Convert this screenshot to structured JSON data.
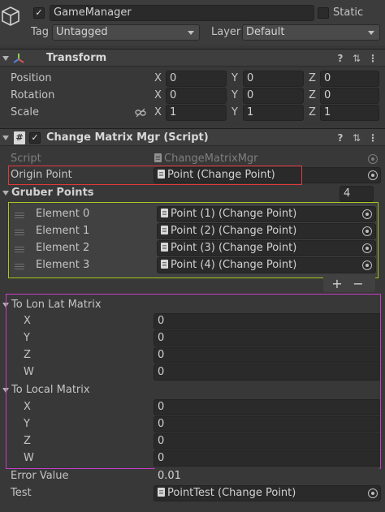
{
  "header": {
    "object_name": "GameManager",
    "static_label": "Static",
    "tag_label": "Tag",
    "tag_value": "Untagged",
    "layer_label": "Layer",
    "layer_value": "Default"
  },
  "transform": {
    "title": "Transform",
    "rows": [
      {
        "label": "Position",
        "x": "0",
        "y": "0",
        "z": "0"
      },
      {
        "label": "Rotation",
        "x": "0",
        "y": "0",
        "z": "0"
      },
      {
        "label": "Scale",
        "x": "1",
        "y": "1",
        "z": "1"
      }
    ],
    "axis_x": "X",
    "axis_y": "Y",
    "axis_z": "Z"
  },
  "script_component": {
    "title": "Change Matrix Mgr (Script)",
    "script_label": "Script",
    "script_value": "ChangeMatrixMgr",
    "origin_label": "Origin Point",
    "origin_value": "Point (Change Point)",
    "gruber_label": "Gruber Points",
    "gruber_count": "4",
    "elements": [
      {
        "label": "Element 0",
        "value": "Point (1) (Change Point)"
      },
      {
        "label": "Element 1",
        "value": "Point (2) (Change Point)"
      },
      {
        "label": "Element 2",
        "value": "Point (3) (Change Point)"
      },
      {
        "label": "Element 3",
        "value": "Point (4) (Change Point)"
      }
    ],
    "add_label": "+",
    "remove_label": "−",
    "lon_lat_label": "To Lon Lat Matrix",
    "lon_lat": [
      {
        "label": "X",
        "value": "0"
      },
      {
        "label": "Y",
        "value": "0"
      },
      {
        "label": "Z",
        "value": "0"
      },
      {
        "label": "W",
        "value": "0"
      }
    ],
    "local_label": "To Local Matrix",
    "local": [
      {
        "label": "X",
        "value": "0"
      },
      {
        "label": "Y",
        "value": "0"
      },
      {
        "label": "Z",
        "value": "0"
      },
      {
        "label": "W",
        "value": "0"
      }
    ],
    "error_label": "Error Value",
    "error_value": "0.01",
    "test_label": "Test",
    "test_value": "PointTest (Change Point)"
  },
  "colors": {
    "origin_highlight": "#e0393e",
    "gruber_highlight": "#a6c81e",
    "matrix_highlight": "#c83cc8"
  }
}
